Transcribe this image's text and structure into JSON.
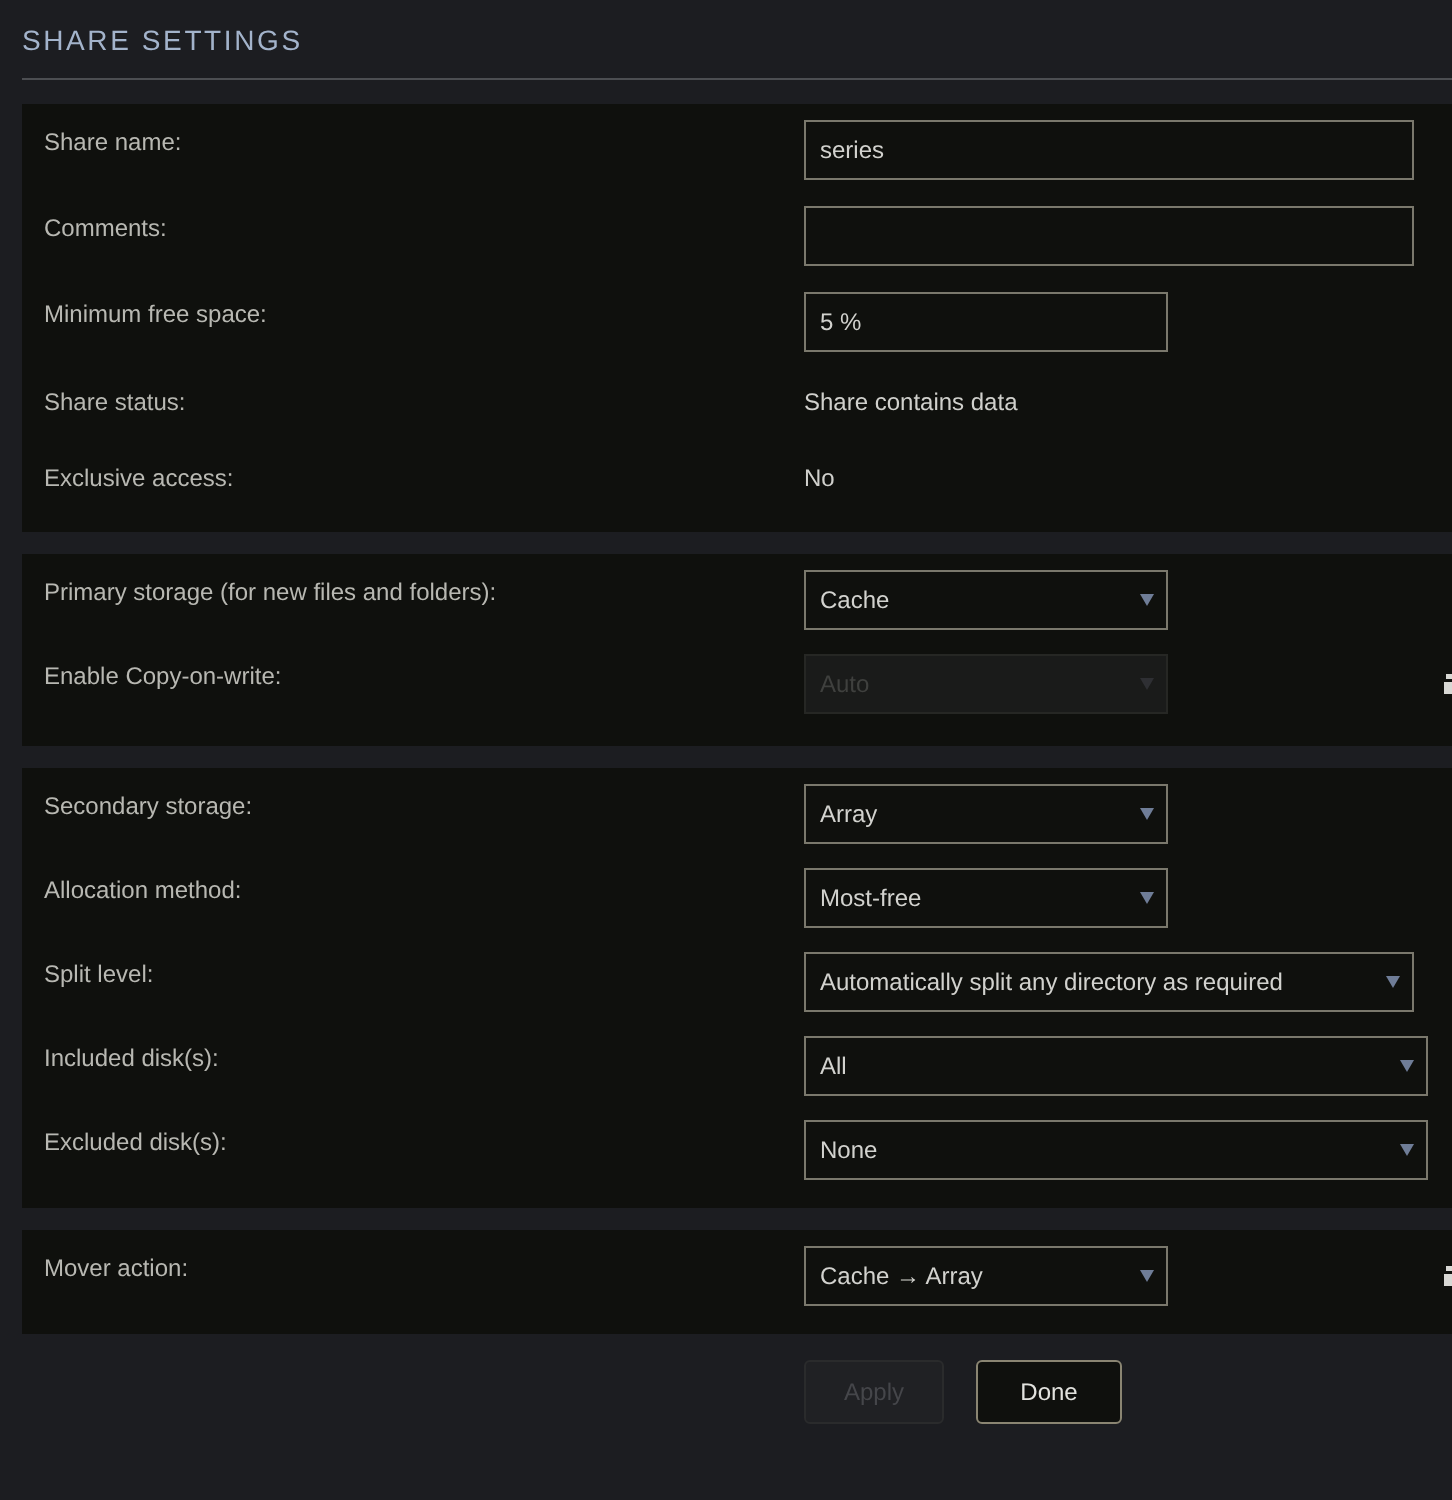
{
  "title": "SHARE SETTINGS",
  "sections": [
    {
      "rows": [
        {
          "kind": "text",
          "label": "Share name:",
          "value": "series",
          "info": false
        },
        {
          "kind": "text",
          "label": "Comments:",
          "info": false
        },
        {
          "kind": "text",
          "label": "Minimum free space:",
          "value": "5 %",
          "info": false
        },
        {
          "kind": "static",
          "label": "Share status:",
          "value": "Share contains data",
          "info": false
        },
        {
          "kind": "static",
          "label": "Exclusive access:",
          "value": "No",
          "info": false
        }
      ]
    },
    {
      "rows": [
        {
          "kind": "select",
          "label": "Primary storage (for new files and folders):",
          "value": "Cache",
          "disabled": false,
          "info": false
        },
        {
          "kind": "select",
          "label": "Enable Copy-on-write:",
          "value": "Auto",
          "disabled": true,
          "info": true
        }
      ]
    },
    {
      "rows": [
        {
          "kind": "select",
          "label": "Secondary storage:",
          "value": "Array",
          "disabled": false,
          "info": false
        },
        {
          "kind": "select",
          "label": "Allocation method:",
          "value": "Most-free",
          "disabled": false,
          "info": false
        },
        {
          "kind": "select",
          "label": "Split level:",
          "value": "Automatically split any directory as required",
          "disabled": false,
          "info": false
        },
        {
          "kind": "select",
          "label": "Included disk(s):",
          "value": "All",
          "disabled": false,
          "info": false
        },
        {
          "kind": "select",
          "label": "Excluded disk(s):",
          "value": "None",
          "disabled": false,
          "info": false
        }
      ]
    },
    {
      "rows": [
        {
          "kind": "select",
          "label": "Mover action:",
          "value": "Cache → Array",
          "disabled": false,
          "info": true
        }
      ]
    }
  ],
  "buttons": [
    {
      "label": "Apply",
      "disabled": true
    },
    {
      "label": "Done",
      "disabled": false
    }
  ]
}
